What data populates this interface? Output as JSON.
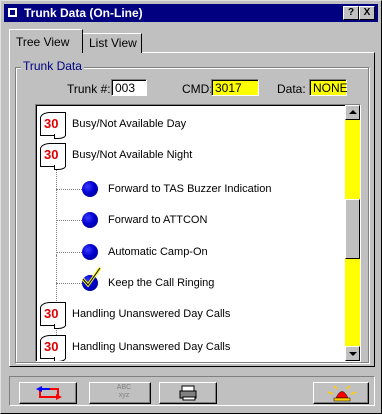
{
  "window": {
    "title": "Trunk Data (On-Line)",
    "help_btn": "?",
    "close_btn": "X"
  },
  "tabs": [
    {
      "label": "Tree View",
      "active": true
    },
    {
      "label": "List View",
      "active": false
    }
  ],
  "group": {
    "label": "Trunk Data",
    "trunk_label": "Trunk #:",
    "trunk_value": "003",
    "cmd_label": "CMD:",
    "cmd_value": "3017",
    "data_label": "Data:",
    "data_value": "NONE",
    "highlight_color": "#ffff00"
  },
  "tree": {
    "items": [
      {
        "icon": "30",
        "label": "Busy/Not Available Day",
        "level": 0
      },
      {
        "icon": "30",
        "label": "Busy/Not Available Night",
        "level": 0
      },
      {
        "icon": "blue-ball-icon",
        "label": "Forward to TAS Buzzer Indication",
        "level": 1
      },
      {
        "icon": "blue-ball-icon",
        "label": "Forward to ATTCON",
        "level": 1
      },
      {
        "icon": "blue-ball-icon",
        "label": "Automatic Camp-On",
        "level": 1
      },
      {
        "icon": "checkmark-ball-icon",
        "label": "Keep the Call Ringing",
        "level": 1
      },
      {
        "icon": "30",
        "label": "Handling Unanswered Day Calls",
        "level": 0
      },
      {
        "icon": "30",
        "label": "Handling Unanswered Day Calls",
        "level": 0
      }
    ]
  },
  "toolbar": {
    "btn_swap_icon": "swap-arrows-icon",
    "btn_abc_label": "ABC xyz",
    "btn_print_icon": "printer-icon",
    "btn_alarm_icon": "alarm-light-icon"
  }
}
